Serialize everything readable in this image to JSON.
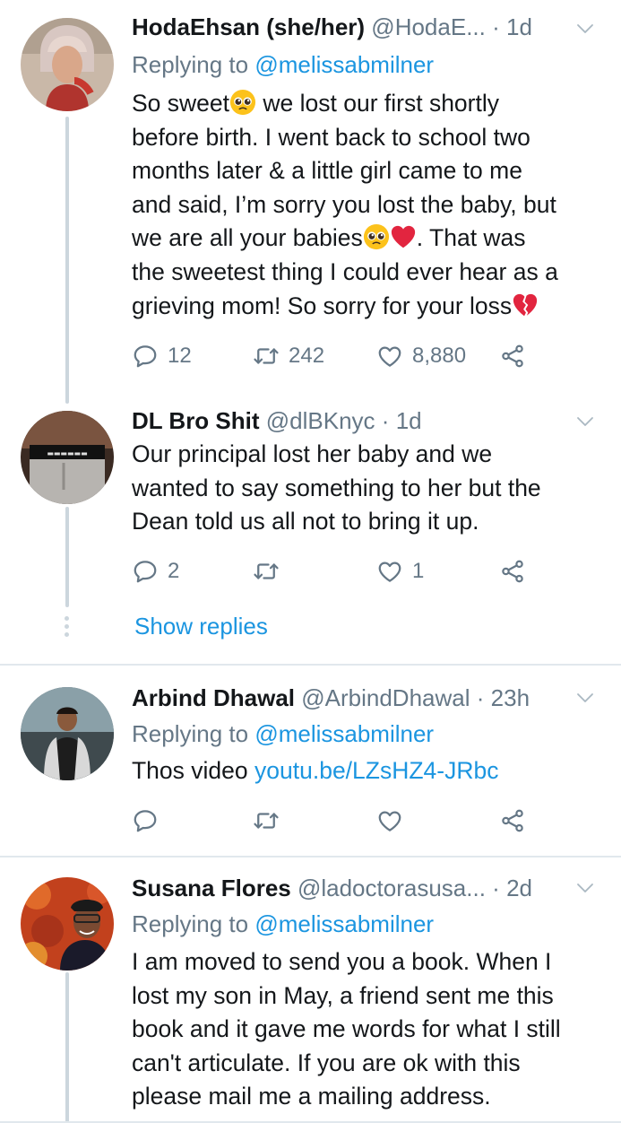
{
  "colors": {
    "link": "#1b95e0",
    "secondary": "#657786",
    "text": "#14171a",
    "divider": "#e1e8ed"
  },
  "tweets": [
    {
      "name": "HodaEhsan (she/her)",
      "handle": "@HodaE...",
      "time": "1d",
      "replying_prefix": "Replying to",
      "replying_to": "@melissabmilner",
      "body_lines": [
        "So sweet",
        "we lost our first shortly",
        "before birth. I went back to school two",
        "months later & a little girl came to me",
        "and said, I’m sorry you lost the baby, but",
        "we are all your babies",
        ". That was",
        "the sweetest thing I could ever hear as a",
        "grieving mom! So sorry for your loss"
      ],
      "replies": "12",
      "retweets": "242",
      "likes": "8,880"
    },
    {
      "name": "DL Bro Shit",
      "handle": "@dlBKnyc",
      "time": "1d",
      "body_lines": [
        "Our principal lost her baby and we",
        "wanted to say something to her but the",
        "Dean told us all not to bring it up."
      ],
      "replies": "2",
      "retweets": "",
      "likes": "1",
      "show_replies": "Show replies"
    },
    {
      "name": "Arbind Dhawal",
      "handle": "@ArbindDhawal",
      "time": "23h",
      "replying_prefix": "Replying to",
      "replying_to": "@melissabmilner",
      "body_text": "Thos video",
      "body_link": "youtu.be/LZsHZ4-JRbc"
    },
    {
      "name": "Susana Flores",
      "handle": "@ladoctorasusa...",
      "time": "2d",
      "replying_prefix": "Replying to",
      "replying_to": "@melissabmilner",
      "body_lines": [
        "I am moved to send you a book. When I",
        "lost my son in May, a friend sent me this",
        "book and it gave me words for what I still",
        "can't articulate. If you are ok with this",
        "please mail me a mailing address."
      ]
    }
  ],
  "separator": "·",
  "icons": [
    "reply-icon",
    "retweet-icon",
    "like-icon",
    "share-icon",
    "chevron-down-icon",
    "pleading-face-emoji",
    "red-heart-emoji",
    "broken-heart-emoji"
  ]
}
